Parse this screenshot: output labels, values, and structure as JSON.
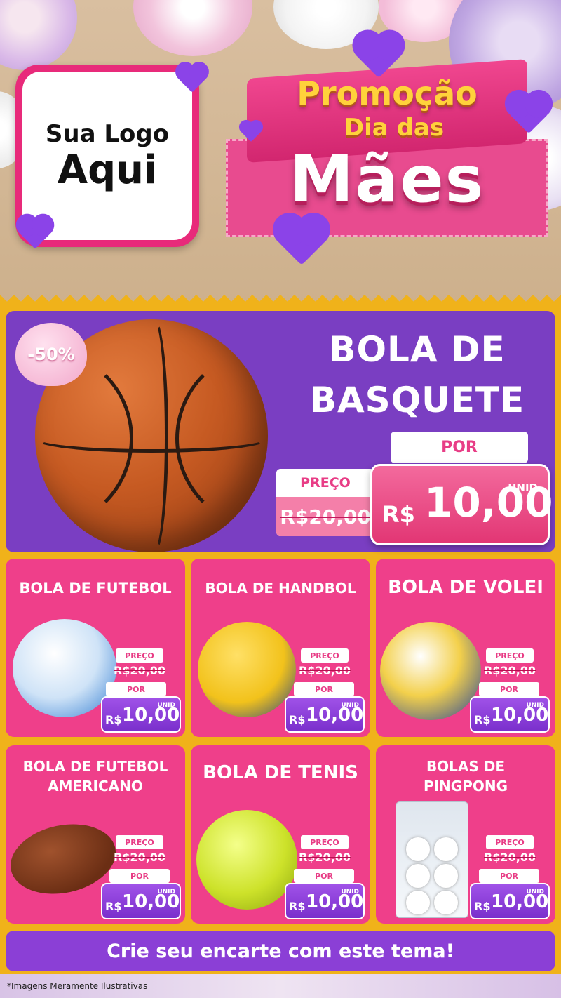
{
  "header": {
    "logo": {
      "line1": "Sua Logo",
      "line2": "Aqui"
    },
    "promo": {
      "line1": "Promoção",
      "line2": "Dia das",
      "line3": "Mães"
    }
  },
  "hero": {
    "discount": "-50%",
    "title_line1": "BOLA DE",
    "title_line2": "BASQUETE",
    "por_label": "POR",
    "preco_label": "PREÇO",
    "old_price": "R$20,00",
    "unid": "UNID",
    "currency": "R$",
    "price": "10,00"
  },
  "products": [
    {
      "name_line1": "BOLA DE FUTEBOL",
      "name_line2": "",
      "preco_label": "PREÇO",
      "old_price": "R$20,00",
      "por_label": "POR",
      "unid": "UNID",
      "currency": "R$",
      "price": "10,00",
      "icon": "soccer-ball-icon"
    },
    {
      "name_line1": "BOLA DE HANDBOL",
      "name_line2": "",
      "preco_label": "PREÇO",
      "old_price": "R$20,00",
      "por_label": "POR",
      "unid": "UNID",
      "currency": "R$",
      "price": "10,00",
      "icon": "handball-icon"
    },
    {
      "name_line1": "BOLA DE VOLEI",
      "name_line2": "",
      "preco_label": "PREÇO",
      "old_price": "R$20,00",
      "por_label": "POR",
      "unid": "UNID",
      "currency": "R$",
      "price": "10,00",
      "icon": "volleyball-icon"
    },
    {
      "name_line1": "BOLA DE FUTEBOL",
      "name_line2": "AMERICANO",
      "preco_label": "PREÇO",
      "old_price": "R$20,00",
      "por_label": "POR",
      "unid": "UNID",
      "currency": "R$",
      "price": "10,00",
      "icon": "american-football-icon"
    },
    {
      "name_line1": "BOLA DE TENIS",
      "name_line2": "",
      "preco_label": "PREÇO",
      "old_price": "R$20,00",
      "por_label": "POR",
      "unid": "UNID",
      "currency": "R$",
      "price": "10,00",
      "icon": "tennis-ball-icon"
    },
    {
      "name_line1": "BOLAS DE",
      "name_line2": "PINGPONG",
      "preco_label": "PREÇO",
      "old_price": "R$20,00",
      "por_label": "POR",
      "unid": "UNID",
      "currency": "R$",
      "price": "10,00",
      "icon": "pingpong-balls-icon"
    }
  ],
  "cta": {
    "label": "Crie seu encarte com este tema!"
  },
  "footnote": "*Imagens Meramente Ilustrativas",
  "colors": {
    "pink": "#ef3f8a",
    "purple": "#7a3ec2",
    "yellow": "#f0b21a"
  }
}
